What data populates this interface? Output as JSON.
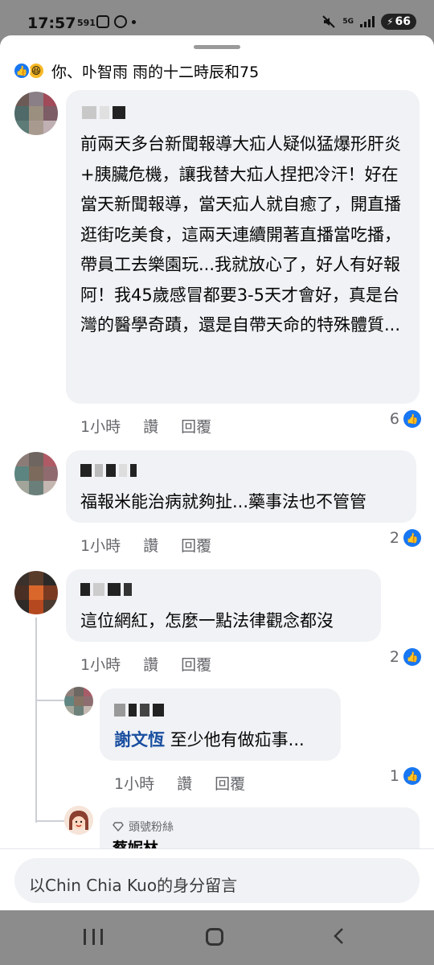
{
  "status_bar": {
    "time": "17:57",
    "small_label": "591",
    "net_label": "5G",
    "battery": "66"
  },
  "reactions": {
    "summary": "你、卟智雨 雨的十二時辰和75"
  },
  "comments": [
    {
      "text": "前兩天多台新聞報導大疝人疑似猛爆形肝炎+胰臟危機，讓我替大疝人捏把冷汗！好在當天新聞報導，當天疝人就自癒了，開直播逛街吃美食，這兩天連續開著直播當吃播，帶員工去樂園玩...我就放心了，好人有好報阿！我45歲感冒都要3-5天才會好，真是台灣的醫學奇蹟，還是自帶天命的特殊體質...",
      "time": "1小時",
      "like_action": "讚",
      "reply_action": "回覆",
      "reaction_count": "6"
    },
    {
      "text": "福報米能治病就夠扯...藥事法也不管管",
      "time": "1小時",
      "like_action": "讚",
      "reply_action": "回覆",
      "reaction_count": "2"
    },
    {
      "text": "這位網紅，怎麼一點法律觀念都沒",
      "time": "1小時",
      "like_action": "讚",
      "reply_action": "回覆",
      "reaction_count": "2"
    }
  ],
  "reply": {
    "mention": "謝文恆",
    "text": "至少他有做疝事...",
    "time": "1小時",
    "like_action": "讚",
    "reply_action": "回覆",
    "reaction_count": "1"
  },
  "partial_reply": {
    "badge": "頭號粉絲",
    "name": "蔡妮林"
  },
  "composer": {
    "placeholder": "以Chin Chia Kuo的身分留言"
  },
  "colors": {
    "accent": "#1877f2",
    "bubble": "#f0f2f5",
    "secondary_text": "#65676b",
    "mention": "#1a4fa0"
  },
  "icons": [
    "mute-icon",
    "signal-icon",
    "battery-icon",
    "like-icon",
    "haha-icon",
    "diamond-icon",
    "recent-apps-icon",
    "home-icon",
    "back-icon"
  ]
}
